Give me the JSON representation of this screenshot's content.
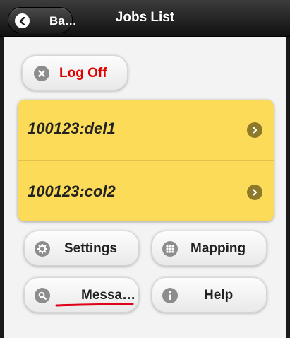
{
  "header": {
    "back_label": "Ba…",
    "title": "Jobs List"
  },
  "actions": {
    "logoff_label": "Log Off"
  },
  "jobs": [
    {
      "label": "100123:del1"
    },
    {
      "label": "100123:col2"
    }
  ],
  "menu": {
    "settings_label": "Settings",
    "mapping_label": "Mapping",
    "messages_label": "Messa…",
    "help_label": "Help"
  },
  "icons": {
    "back": "back-arrow-icon",
    "logoff": "close-icon",
    "job_chevron": "chevron-right-icon",
    "settings": "gear-icon",
    "mapping": "grid-icon",
    "messages": "search-icon",
    "help": "info-icon"
  },
  "colors": {
    "header_bg": "#1c1c1c",
    "logoff_text": "#e00000",
    "jobs_bg": "#fbdb57",
    "annotation_underline": "#e0001a"
  }
}
